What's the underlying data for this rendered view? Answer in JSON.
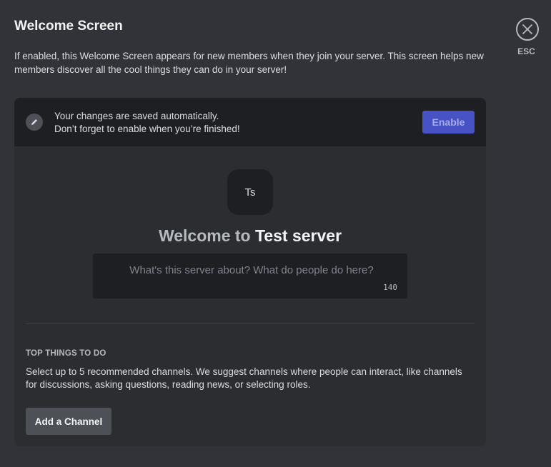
{
  "header": {
    "title": "Welcome Screen",
    "description": "If enabled, this Welcome Screen appears for new members when they join your server. This screen helps new members discover all the cool things they can do in your server!"
  },
  "close": {
    "esc_label": "ESC",
    "icon": "close-icon"
  },
  "notice": {
    "icon": "pencil-icon",
    "line1": "Your changes are saved automatically.",
    "line2": "Don’t forget to enable when you’re finished!",
    "enable_label": "Enable"
  },
  "preview": {
    "server_icon_text": "Ts",
    "welcome_prefix": "Welcome to",
    "server_name": "Test server",
    "description_placeholder": "What's this server about? What do people do here?",
    "description_value": "",
    "char_remaining": "140"
  },
  "top_things": {
    "heading": "TOP THINGS TO DO",
    "description": "Select up to 5 recommended channels. We suggest channels where people can interact, like channels for discussions, asking questions, reading news, or selecting roles.",
    "add_button_label": "Add a Channel"
  },
  "colors": {
    "background": "#313338",
    "card": "#2b2d31",
    "notice_bar": "#1e1f22",
    "enable_button": "#4752c4",
    "secondary_button": "#4e5058"
  }
}
